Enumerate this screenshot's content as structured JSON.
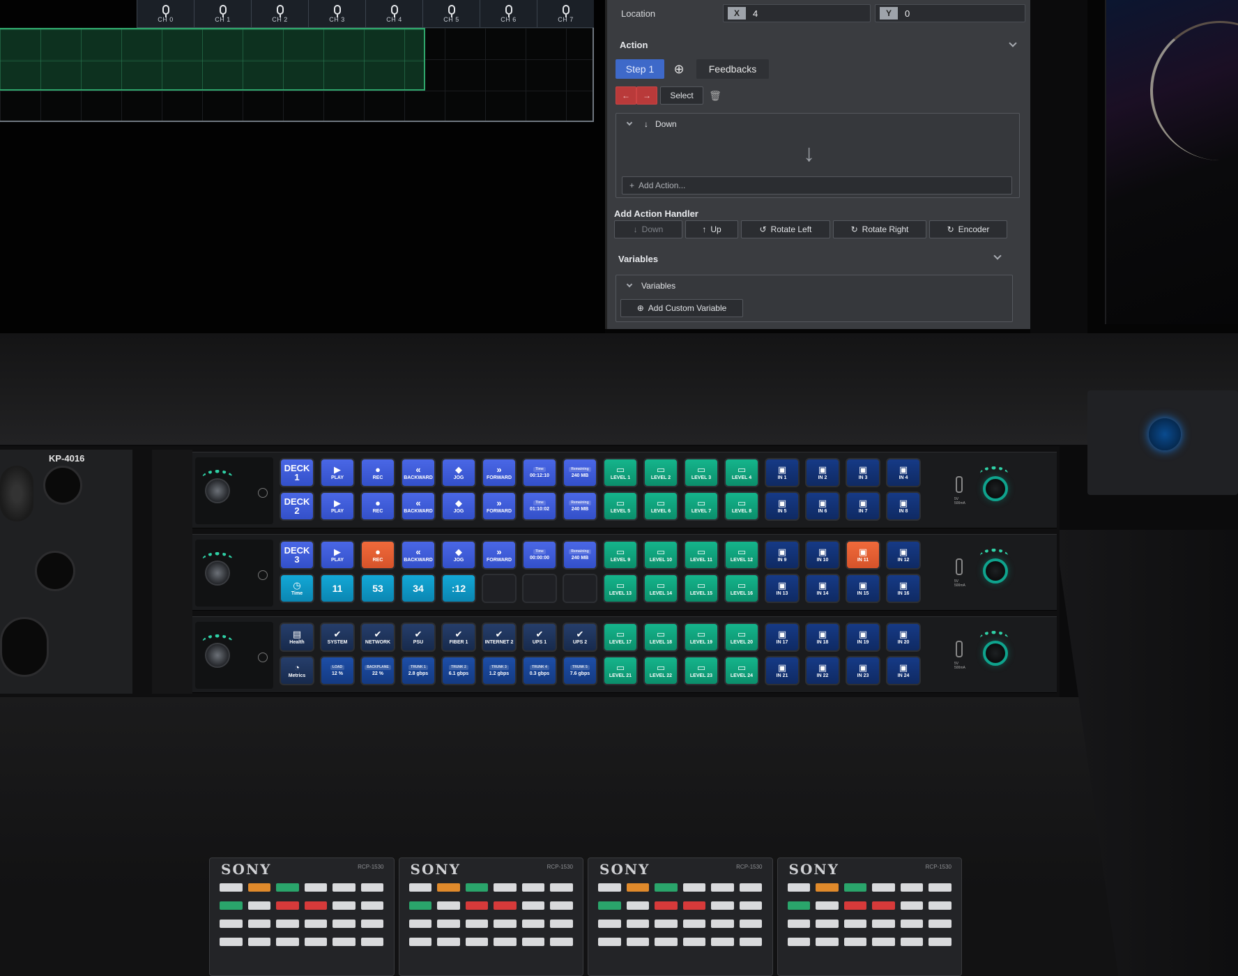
{
  "screen": {
    "channels": [
      "CH 0",
      "CH 1",
      "CH 2",
      "CH 3",
      "CH 4",
      "CH 5",
      "CH 6",
      "CH 7"
    ],
    "location_label": "Location",
    "location_x_tag": "X",
    "location_x": "4",
    "location_y_tag": "Y",
    "location_y": "0",
    "action_header": "Action",
    "tab_step": "Step 1",
    "tab_feedbacks": "Feedbacks",
    "select_label": "Select",
    "down_group": "Down",
    "add_action": "Add Action...",
    "add_action_handler": "Add Action Handler",
    "handlers": [
      "Down",
      "Up",
      "Rotate Left",
      "Rotate Right",
      "Encoder"
    ],
    "variables_header": "Variables",
    "variables_group": "Variables",
    "add_custom_variable": "Add Custom Variable"
  },
  "hardware": {
    "model": "KP-4016",
    "usb_label": "5V\n500mA",
    "rows": [
      [
        {
          "t": "DECK 1",
          "c": "blue",
          "k": "big"
        },
        {
          "t": "PLAY",
          "i": "▶",
          "c": "blue"
        },
        {
          "t": "REC",
          "i": "●",
          "c": "blue"
        },
        {
          "t": "BACKWARD",
          "i": "«",
          "c": "blue"
        },
        {
          "t": "JOG",
          "i": "◆",
          "c": "blue"
        },
        {
          "t": "FORWARD",
          "i": "»",
          "c": "blue"
        },
        {
          "h": "Time",
          "t": "00:12:10",
          "c": "blue"
        },
        {
          "h": "Remaining",
          "t": "240 MB",
          "c": "blue"
        },
        {
          "t": "LEVEL 1",
          "i": "▭",
          "c": "green"
        },
        {
          "t": "LEVEL 2",
          "i": "▭",
          "c": "green"
        },
        {
          "t": "LEVEL 3",
          "i": "▭",
          "c": "green"
        },
        {
          "t": "LEVEL 4",
          "i": "▭",
          "c": "green"
        },
        {
          "t": "IN 1",
          "i": "▣",
          "c": "navy"
        },
        {
          "t": "IN 2",
          "i": "▣",
          "c": "navy"
        },
        {
          "t": "IN 3",
          "i": "▣",
          "c": "navy"
        },
        {
          "t": "IN 4",
          "i": "▣",
          "c": "navy"
        }
      ],
      [
        {
          "t": "DECK 2",
          "c": "blue",
          "k": "big"
        },
        {
          "t": "PLAY",
          "i": "▶",
          "c": "blue"
        },
        {
          "t": "REC",
          "i": "●",
          "c": "blue"
        },
        {
          "t": "BACKWARD",
          "i": "«",
          "c": "blue"
        },
        {
          "t": "JOG",
          "i": "◆",
          "c": "blue"
        },
        {
          "t": "FORWARD",
          "i": "»",
          "c": "blue"
        },
        {
          "h": "Time",
          "t": "01:10:02",
          "c": "blue"
        },
        {
          "h": "Remaining",
          "t": "240 MB",
          "c": "blue"
        },
        {
          "t": "LEVEL 5",
          "i": "▭",
          "c": "green"
        },
        {
          "t": "LEVEL 6",
          "i": "▭",
          "c": "green"
        },
        {
          "t": "LEVEL 7",
          "i": "▭",
          "c": "green"
        },
        {
          "t": "LEVEL 8",
          "i": "▭",
          "c": "green"
        },
        {
          "t": "IN 5",
          "i": "▣",
          "c": "navy"
        },
        {
          "t": "IN 6",
          "i": "▣",
          "c": "navy"
        },
        {
          "t": "IN 7",
          "i": "▣",
          "c": "navy"
        },
        {
          "t": "IN 8",
          "i": "▣",
          "c": "navy"
        }
      ],
      [
        {
          "t": "DECK 3",
          "c": "blue",
          "k": "big"
        },
        {
          "t": "PLAY",
          "i": "▶",
          "c": "blue"
        },
        {
          "t": "REC",
          "i": "●",
          "c": "orange"
        },
        {
          "t": "BACKWARD",
          "i": "«",
          "c": "blue"
        },
        {
          "t": "JOG",
          "i": "◆",
          "c": "blue"
        },
        {
          "t": "FORWARD",
          "i": "»",
          "c": "blue"
        },
        {
          "h": "Time",
          "t": "00:00:00",
          "c": "blue"
        },
        {
          "h": "Remaining",
          "t": "240 MB",
          "c": "blue"
        },
        {
          "t": "LEVEL 9",
          "i": "▭",
          "c": "green"
        },
        {
          "t": "LEVEL 10",
          "i": "▭",
          "c": "green"
        },
        {
          "t": "LEVEL 11",
          "i": "▭",
          "c": "green"
        },
        {
          "t": "LEVEL 12",
          "i": "▭",
          "c": "green"
        },
        {
          "t": "IN 9",
          "i": "▣",
          "c": "navy"
        },
        {
          "t": "IN 10",
          "i": "▣",
          "c": "navy"
        },
        {
          "t": "IN 11",
          "i": "▣",
          "c": "orange"
        },
        {
          "t": "IN 12",
          "i": "▣",
          "c": "navy"
        }
      ],
      [
        {
          "t": "Time",
          "i": "◷",
          "c": "cyan"
        },
        {
          "t": "11",
          "c": "cyan",
          "k": "num"
        },
        {
          "t": "53",
          "c": "cyan",
          "k": "num"
        },
        {
          "t": "34",
          "c": "cyan",
          "k": "num"
        },
        {
          "t": ":12",
          "c": "cyan",
          "k": "num"
        },
        {
          "t": "",
          "c": "dark"
        },
        {
          "t": "",
          "c": "dark"
        },
        {
          "t": "",
          "c": "dark"
        },
        {
          "t": "LEVEL 13",
          "i": "▭",
          "c": "green"
        },
        {
          "t": "LEVEL 14",
          "i": "▭",
          "c": "green"
        },
        {
          "t": "LEVEL 15",
          "i": "▭",
          "c": "green"
        },
        {
          "t": "LEVEL 16",
          "i": "▭",
          "c": "green"
        },
        {
          "t": "IN 13",
          "i": "▣",
          "c": "navy"
        },
        {
          "t": "IN 14",
          "i": "▣",
          "c": "navy"
        },
        {
          "t": "IN 15",
          "i": "▣",
          "c": "navy"
        },
        {
          "t": "IN 16",
          "i": "▣",
          "c": "navy"
        }
      ],
      [
        {
          "t": "Health",
          "i": "▤",
          "c": "slate"
        },
        {
          "t": "SYSTEM",
          "i": "✔",
          "c": "slate"
        },
        {
          "t": "NETWORK",
          "i": "✔",
          "c": "slate"
        },
        {
          "t": "PSU",
          "i": "✔",
          "c": "slate"
        },
        {
          "t": "FIBER 1",
          "i": "✔",
          "c": "slate"
        },
        {
          "t": "INTERNET 2",
          "i": "✔",
          "c": "slate"
        },
        {
          "t": "UPS 1",
          "i": "✔",
          "c": "slate"
        },
        {
          "t": "UPS 2",
          "i": "✔",
          "c": "slate"
        },
        {
          "t": "LEVEL 17",
          "i": "▭",
          "c": "green"
        },
        {
          "t": "LEVEL 18",
          "i": "▭",
          "c": "green"
        },
        {
          "t": "LEVEL 19",
          "i": "▭",
          "c": "green"
        },
        {
          "t": "LEVEL 20",
          "i": "▭",
          "c": "green"
        },
        {
          "t": "IN 17",
          "i": "▣",
          "c": "navy"
        },
        {
          "t": "IN 18",
          "i": "▣",
          "c": "navy"
        },
        {
          "t": "IN 19",
          "i": "▣",
          "c": "navy"
        },
        {
          "t": "IN 20",
          "i": "▣",
          "c": "navy"
        }
      ],
      [
        {
          "t": "Metrics",
          "i": "◔",
          "c": "slate"
        },
        {
          "h": "LOAD",
          "t": "12 %",
          "c": "cobalt"
        },
        {
          "h": "BACKPLANE",
          "t": "22 %",
          "c": "cobalt"
        },
        {
          "h": "TRUNK 1",
          "t": "2.8 gbps",
          "c": "cobalt"
        },
        {
          "h": "TRUNK 2",
          "t": "6.1 gbps",
          "c": "cobalt"
        },
        {
          "h": "TRUNK 3",
          "t": "1.2 gbps",
          "c": "cobalt"
        },
        {
          "h": "TRUNK 4",
          "t": "0.3 gbps",
          "c": "cobalt"
        },
        {
          "h": "TRUNK 5",
          "t": "7.6 gbps",
          "c": "cobalt"
        },
        {
          "t": "LEVEL 21",
          "i": "▭",
          "c": "green"
        },
        {
          "t": "LEVEL 22",
          "i": "▭",
          "c": "green"
        },
        {
          "t": "LEVEL 23",
          "i": "▭",
          "c": "green"
        },
        {
          "t": "LEVEL 24",
          "i": "▭",
          "c": "green"
        },
        {
          "t": "IN 21",
          "i": "▣",
          "c": "navy"
        },
        {
          "t": "IN 22",
          "i": "▣",
          "c": "navy"
        },
        {
          "t": "IN 23",
          "i": "▣",
          "c": "navy"
        },
        {
          "t": "IN 24",
          "i": "▣",
          "c": "navy"
        }
      ]
    ],
    "rcp_brand": "SONY",
    "rcp_model": "RCP-1530"
  },
  "colors": {
    "accent_blue": "#4a67e6",
    "green_key": "#15b58c",
    "orange_key": "#f06a3b",
    "encoder_ring": "#0fa38d"
  }
}
